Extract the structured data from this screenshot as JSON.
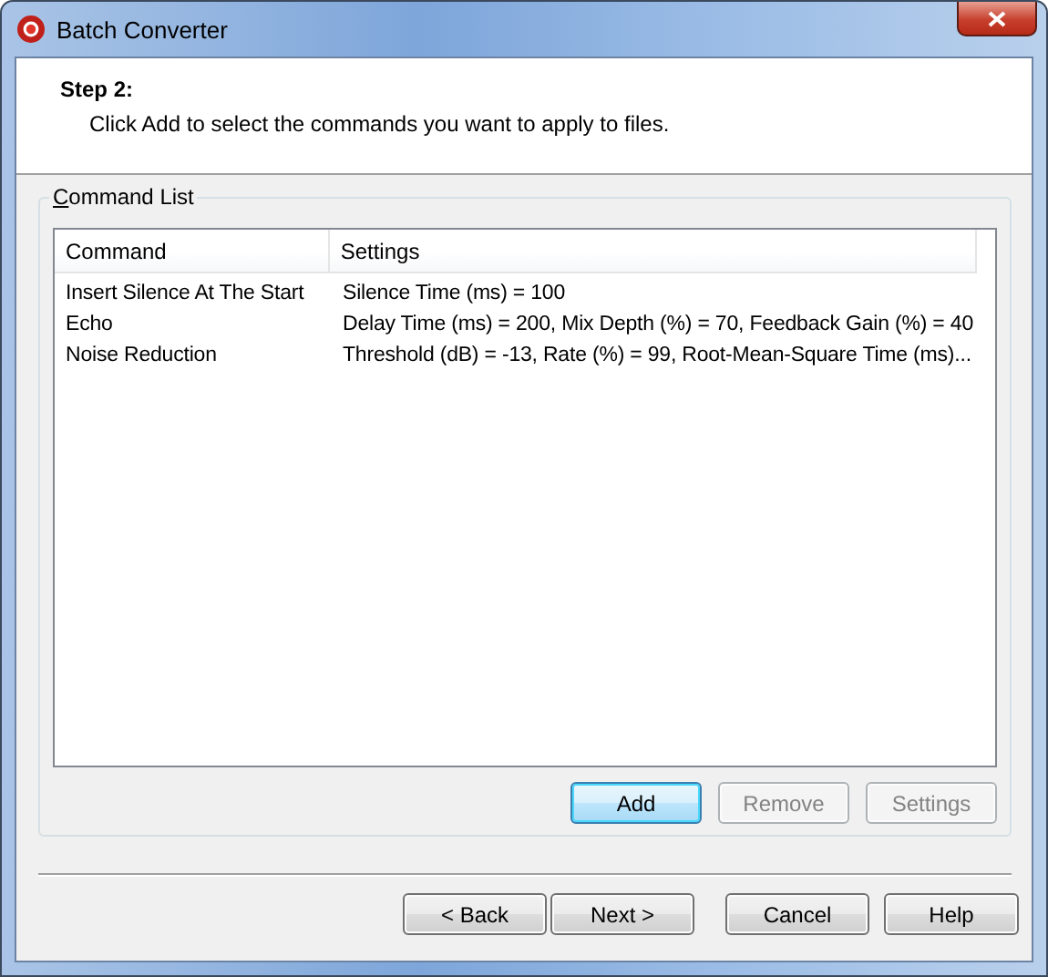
{
  "window": {
    "title": "Batch Converter"
  },
  "header": {
    "step": "Step 2:",
    "instruction": "Click Add to select the commands you want to apply to files."
  },
  "group": {
    "label": "Command List"
  },
  "table": {
    "columns": [
      "Command",
      "Settings"
    ],
    "rows": [
      {
        "command": "Insert Silence At The Start",
        "settings": "Silence Time (ms) = 100"
      },
      {
        "command": "Echo",
        "settings": "Delay Time (ms) = 200, Mix Depth (%) = 70, Feedback Gain (%) = 40"
      },
      {
        "command": "Noise Reduction",
        "settings": "Threshold (dB) = -13, Rate (%) = 99, Root-Mean-Square Time (ms)..."
      }
    ]
  },
  "list_buttons": [
    {
      "label": "Add",
      "default": true,
      "disabled": false
    },
    {
      "label": "Remove",
      "default": false,
      "disabled": true
    },
    {
      "label": "Settings",
      "default": false,
      "disabled": true
    }
  ],
  "footer_buttons": [
    {
      "label": "< Back",
      "default": false,
      "disabled": false
    },
    {
      "label": "Next >",
      "default": false,
      "disabled": false
    },
    {
      "label": "Cancel",
      "default": false,
      "disabled": false
    },
    {
      "label": "Help",
      "default": false,
      "disabled": false
    }
  ]
}
